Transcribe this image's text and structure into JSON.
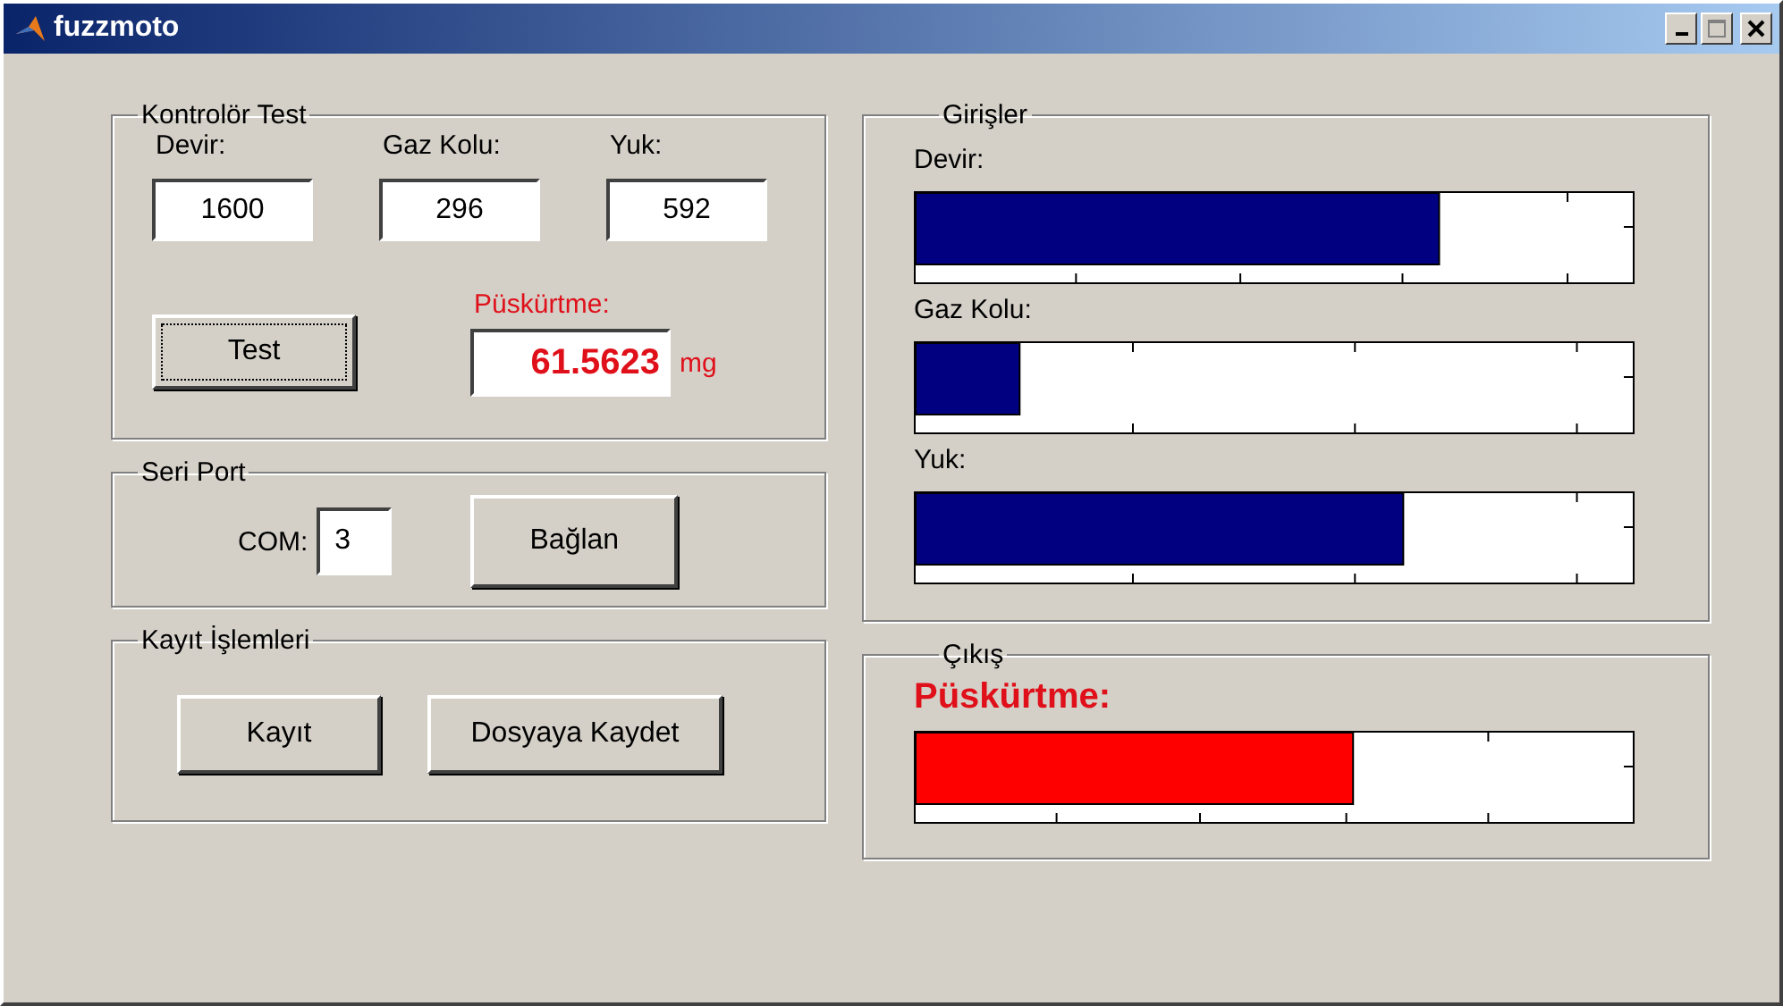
{
  "window": {
    "title": "fuzzmoto"
  },
  "controller_test": {
    "title": "Kontrolör Test",
    "inputs": [
      {
        "label": "Devir:",
        "value": "1600"
      },
      {
        "label": "Gaz Kolu:",
        "value": "296"
      },
      {
        "label": "Yuk:",
        "value": "592"
      }
    ],
    "test_button": {
      "label": "Test",
      "focused": true
    },
    "output_label": "Püskürtme:",
    "output_value": "61.5623",
    "output_unit": "mg"
  },
  "serial_port": {
    "title": "Seri Port",
    "com_label": "COM:",
    "com_value": "3",
    "connect_button": "Bağlan"
  },
  "recording": {
    "title": "Kayıt İşlemleri",
    "buttons": [
      "Kayıt",
      "Dosyaya Kaydet"
    ]
  },
  "inputs_panel": {
    "title": "Girişler",
    "meters": [
      {
        "label": "Devir:",
        "level": 0.73
      },
      {
        "label": "Gaz Kolu:",
        "level": 0.145
      },
      {
        "label": "Yuk:",
        "level": 0.68
      }
    ]
  },
  "output_panel": {
    "title": "Çıkış",
    "label": "Püskürtme:",
    "level": 0.61
  }
}
